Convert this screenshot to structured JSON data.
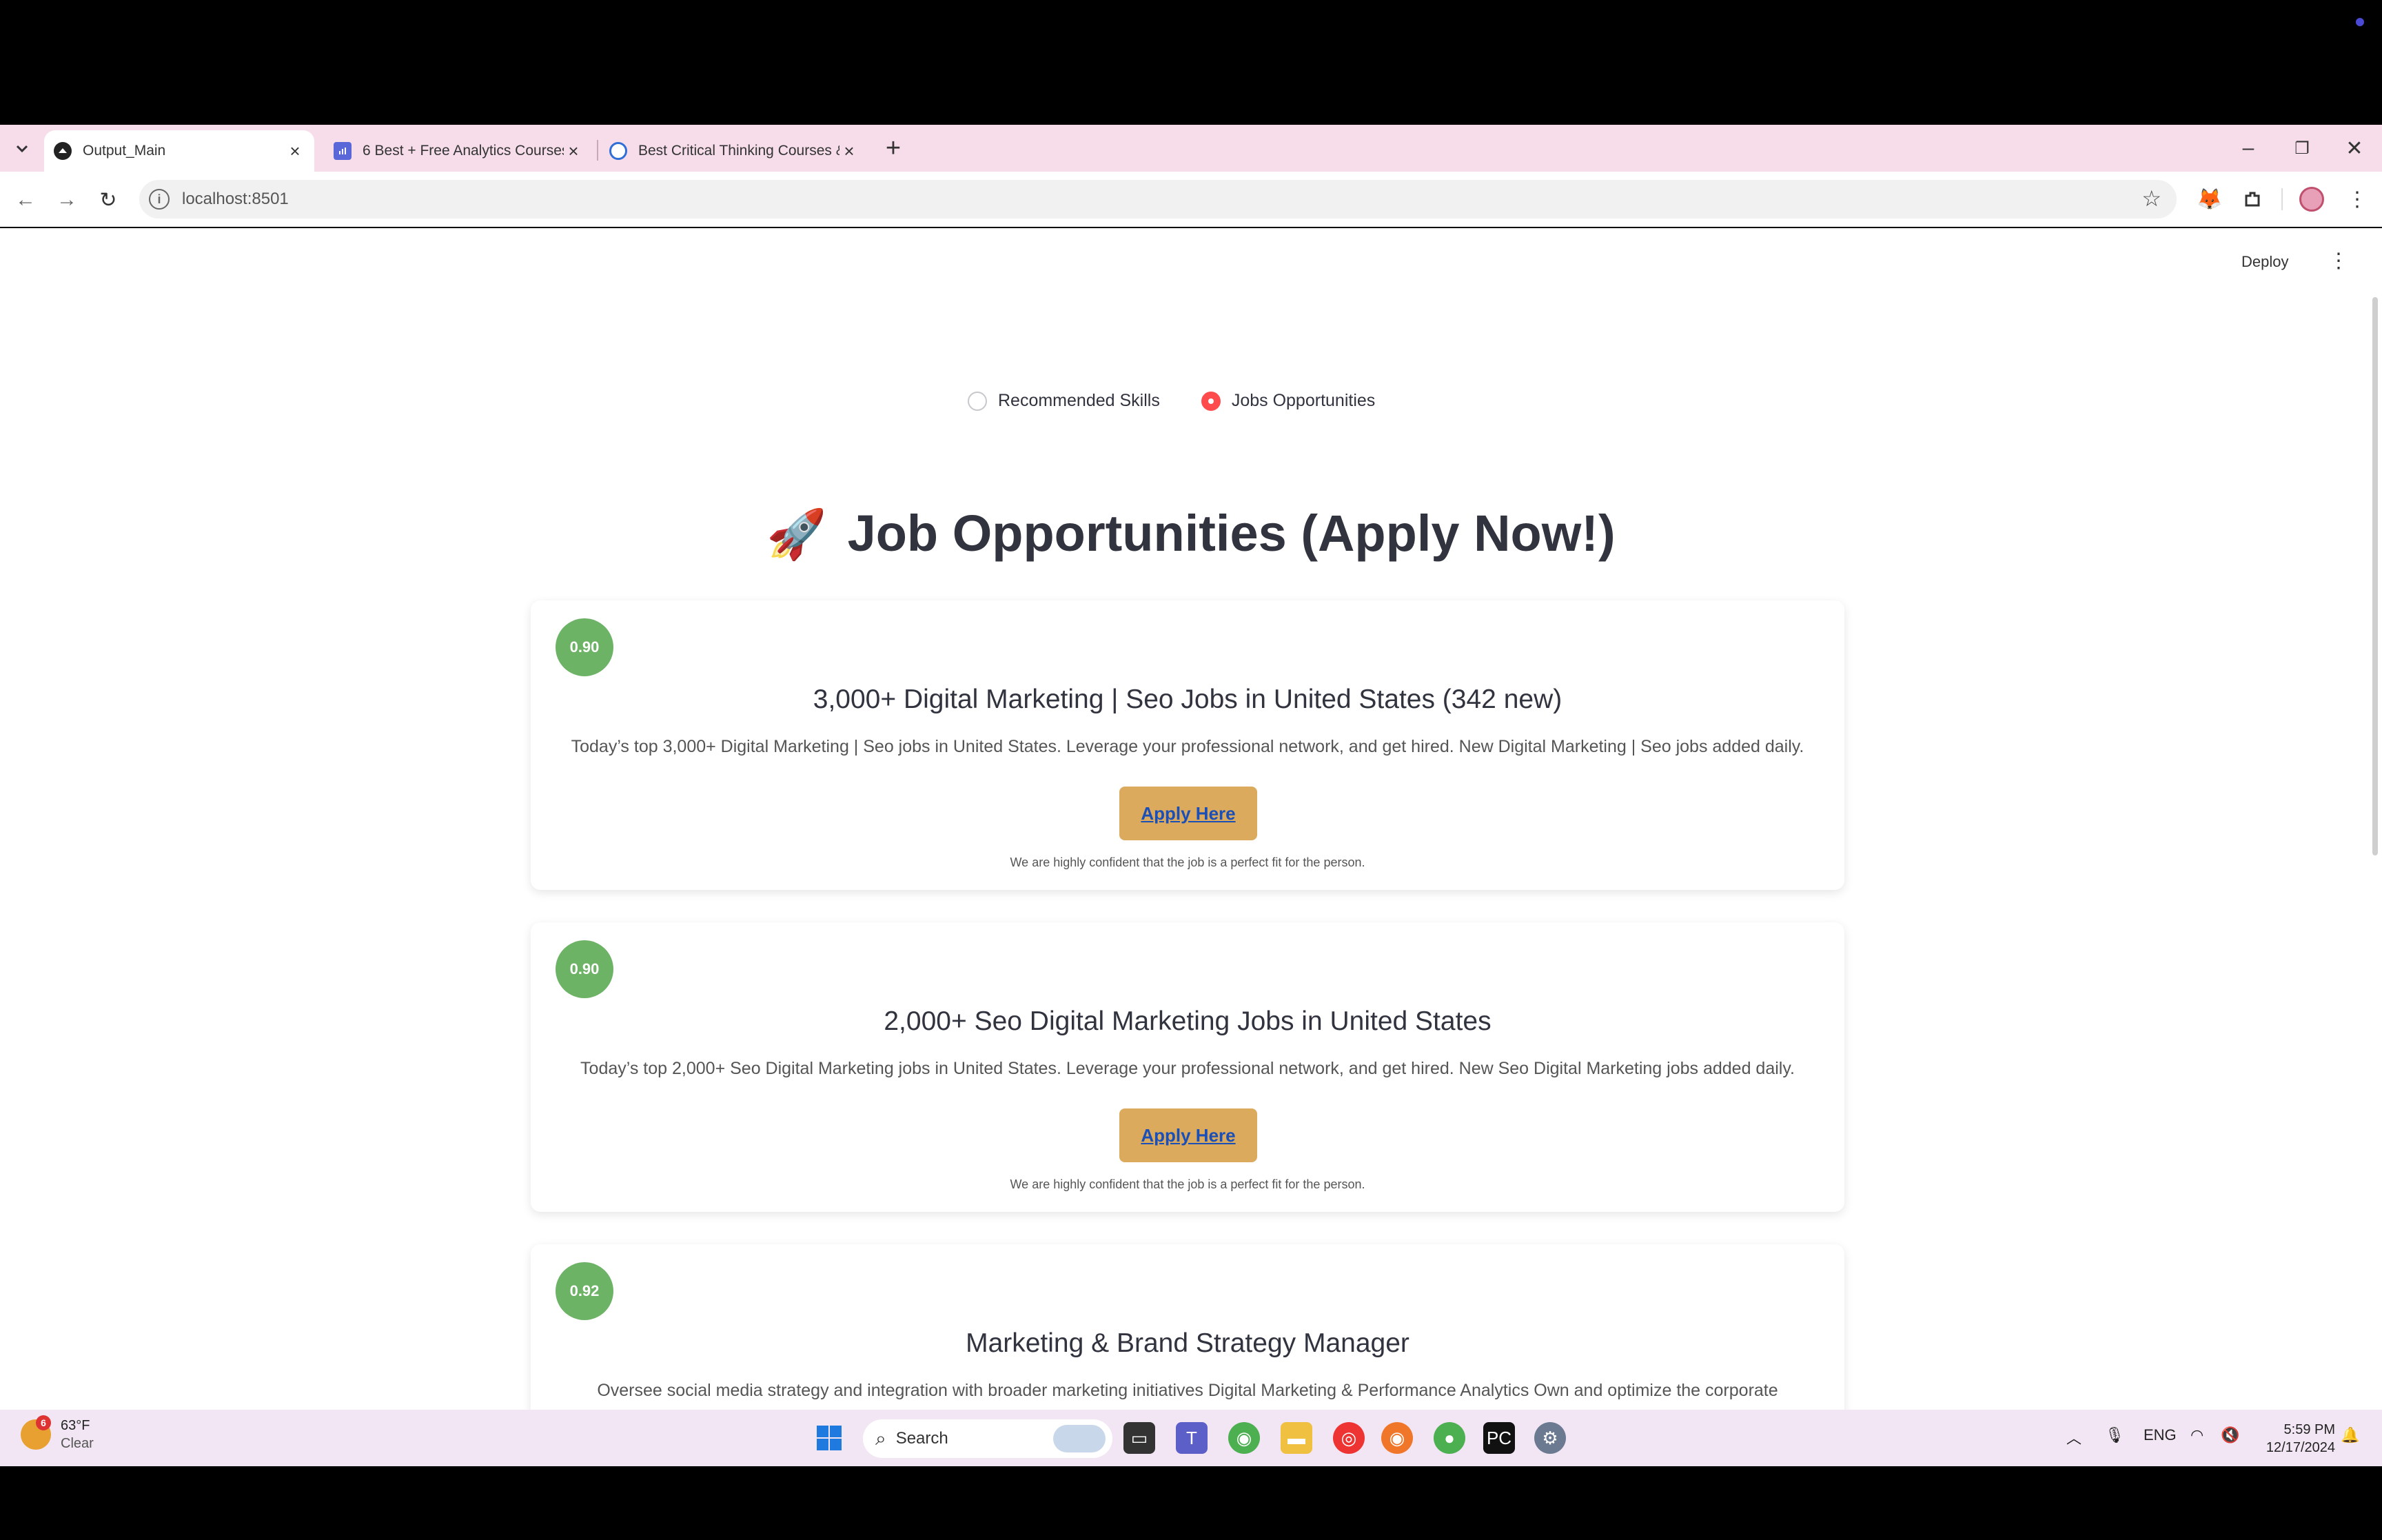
{
  "browser": {
    "tabs": [
      {
        "title": "Output_Main",
        "active": true
      },
      {
        "title": "6 Best + Free Analytics Courses",
        "active": false
      },
      {
        "title": "Best Critical Thinking Courses &",
        "active": false
      }
    ],
    "url": "localhost:8501"
  },
  "app": {
    "deploy_label": "Deploy",
    "radio_options": [
      {
        "label": "Recommended Skills",
        "selected": false
      },
      {
        "label": "Jobs Opportunities",
        "selected": true
      }
    ],
    "heading": "Job Opportunities (Apply Now!)",
    "heading_icon": "rocket-icon",
    "jobs": [
      {
        "score": "0.90",
        "title": "3,000+ Digital Marketing | Seo Jobs in United States (342 new)",
        "description": "Today’s top 3,000+ Digital Marketing | Seo jobs in United States. Leverage your professional network, and get hired. New Digital Marketing | Seo jobs added daily.",
        "apply_label": "Apply Here",
        "note": "We are highly confident that the job is a perfect fit for the person."
      },
      {
        "score": "0.90",
        "title": "2,000+ Seo Digital Marketing Jobs in United States",
        "description": "Today’s top 2,000+ Seo Digital Marketing jobs in United States. Leverage your professional network, and get hired. New Seo Digital Marketing jobs added daily.",
        "apply_label": "Apply Here",
        "note": "We are highly confident that the job is a perfect fit for the person."
      },
      {
        "score": "0.92",
        "title": "Marketing & Brand Strategy Manager",
        "description": "Oversee social media strategy and integration with broader marketing initiatives Digital Marketing & Performance Analytics Own and optimize the corporate",
        "apply_label": "",
        "note": ""
      }
    ],
    "colors": {
      "score_badge": "#6cb365",
      "apply_button": "#dcaa5c",
      "radio_selected": "#ff4b4b"
    }
  },
  "taskbar": {
    "weather_temp": "63°F",
    "weather_cond": "Clear",
    "weather_badge": "6",
    "search_placeholder": "Search",
    "language": "ENG",
    "time": "5:59 PM",
    "date": "12/17/2024"
  }
}
